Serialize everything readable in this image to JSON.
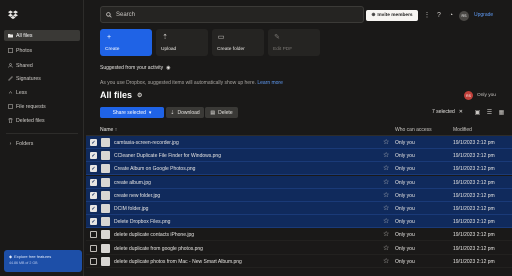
{
  "sidebar": {
    "items": [
      {
        "label": "All files",
        "icon": "folder-icon",
        "active": true
      },
      {
        "label": "Photos",
        "icon": "photos-icon"
      },
      {
        "label": "Shared",
        "icon": "shared-icon"
      },
      {
        "label": "Signatures",
        "icon": "signature-icon"
      },
      {
        "label": "Less",
        "icon": "chevron-up-icon"
      },
      {
        "label": "File requests",
        "icon": "file-request-icon"
      },
      {
        "label": "Deleted files",
        "icon": "trash-icon"
      }
    ],
    "folders_label": "Folders",
    "promo": {
      "title": "Explore free features",
      "usage": "44.86 MB of 2 GB"
    }
  },
  "topbar": {
    "search_placeholder": "Search",
    "invite_label": "Invite members",
    "avatar_initials": "RS",
    "upgrade_label": "Upgrade"
  },
  "actions": [
    {
      "label": "Create",
      "icon": "plus-icon",
      "primary": true
    },
    {
      "label": "Upload",
      "icon": "upload-icon"
    },
    {
      "label": "Create folder",
      "icon": "new-folder-icon"
    },
    {
      "label": "Edit PDF",
      "icon": "edit-pdf-icon",
      "disabled": true
    }
  ],
  "suggested": {
    "title": "Suggested from your activity",
    "note": "As you use Dropbox, suggested items will automatically show up here.",
    "learn_more": "Learn more"
  },
  "main": {
    "title": "All files",
    "owner_initials": "RS",
    "owner_label": "Only you",
    "share_label": "Share selected",
    "download_label": "Download",
    "delete_label": "Delete",
    "selected_count": "7 selected"
  },
  "table": {
    "headers": {
      "name": "Name",
      "access": "Who can access",
      "modified": "Modified"
    },
    "rows": [
      {
        "name": "camtasia-screen-recorder.jpg",
        "access": "Only you",
        "modified": "19/1/2023 2:12 pm",
        "selected": true
      },
      {
        "name": "CCleaner Duplicate File Finder for Windows.png",
        "access": "Only you",
        "modified": "19/1/2023 2:12 pm",
        "selected": true
      },
      {
        "name": "Create Album on Google Photos.png",
        "access": "Only you",
        "modified": "19/1/2023 2:12 pm",
        "selected": true
      },
      {
        "name": "create album.jpg",
        "access": "Only you",
        "modified": "19/1/2023 2:12 pm",
        "selected": true
      },
      {
        "name": "create new folder.jpg",
        "access": "Only you",
        "modified": "19/1/2023 2:12 pm",
        "selected": true
      },
      {
        "name": "DCIM folder.jpg",
        "access": "Only you",
        "modified": "19/1/2023 2:12 pm",
        "selected": true
      },
      {
        "name": "Delete Dropbox Files.png",
        "access": "Only you",
        "modified": "19/1/2023 2:12 pm",
        "selected": true
      },
      {
        "name": "delete duplicate contacts iPhone.jpg",
        "access": "Only you",
        "modified": "19/1/2023 2:12 pm",
        "selected": false
      },
      {
        "name": "delete duplicate from google photos.png",
        "access": "Only you",
        "modified": "19/1/2023 2:12 pm",
        "selected": false
      },
      {
        "name": "delete duplicate photos from Mac - New Smart Album.png",
        "access": "Only you",
        "modified": "19/1/2023 2:12 pm",
        "selected": false
      }
    ]
  }
}
